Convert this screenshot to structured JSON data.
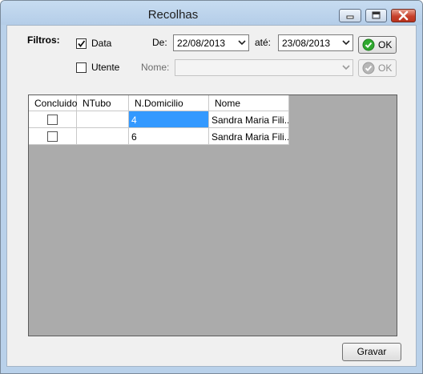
{
  "window": {
    "title": "Recolhas"
  },
  "filters": {
    "label": "Filtros:",
    "data": {
      "label": "Data",
      "checked": true
    },
    "utente": {
      "label": "Utente",
      "checked": false
    },
    "date_from_label": "De:",
    "date_from": "22/08/2013",
    "date_to_label": "até:",
    "date_to": "23/08/2013",
    "ok_label": "OK",
    "nome_label": "Nome:",
    "nome_value": "",
    "ok2_label": "OK"
  },
  "table": {
    "columns": [
      "Concluido",
      "NTubo",
      "N.Domicilio",
      "Nome"
    ],
    "rows": [
      {
        "concluido": false,
        "ntubo": "",
        "ndomicilio": "4",
        "nome": "Sandra Maria Fili..."
      },
      {
        "concluido": false,
        "ntubo": "",
        "ndomicilio": "6",
        "nome": "Sandra Maria Fili..."
      }
    ]
  },
  "footer": {
    "save_label": "Gravar"
  },
  "colors": {
    "selection": "#3399ff",
    "grid_background": "#ababab",
    "ok_green": "#2fa92f"
  },
  "icons": [
    "minimize-icon",
    "maximize-icon",
    "close-icon",
    "checkmark-icon",
    "chevron-down-icon",
    "ok-check-icon"
  ]
}
